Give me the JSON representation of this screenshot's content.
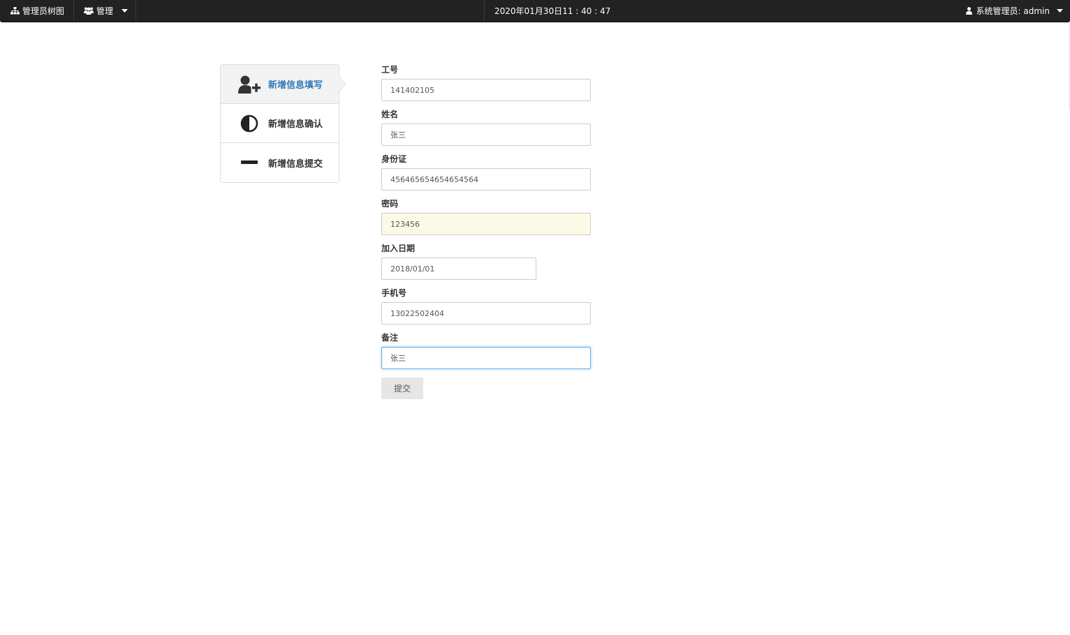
{
  "navbar": {
    "tree_label": "管理员树图",
    "manage_label": "管理",
    "clock": "2020年01月30日11 : 40 : 47",
    "user_label": "系统管理员: admin"
  },
  "steps": [
    {
      "label": "新增信息填写",
      "icon": "user-plus-icon",
      "active": true
    },
    {
      "label": "新增信息确认",
      "icon": "adjust-icon",
      "active": false
    },
    {
      "label": "新增信息提交",
      "icon": "minus-icon",
      "active": false
    }
  ],
  "form": {
    "employee_id": {
      "label": "工号",
      "value": "141402105"
    },
    "name": {
      "label": "姓名",
      "value": "张三"
    },
    "id_card": {
      "label": "身份证",
      "value": "456465654654654564"
    },
    "password": {
      "label": "密码",
      "value": "123456"
    },
    "join_date": {
      "label": "加入日期",
      "value": "2018/01/01"
    },
    "phone": {
      "label": "手机号",
      "value": "13022502404"
    },
    "remark": {
      "label": "备注",
      "value": "张三"
    },
    "submit_label": "提交"
  },
  "colors": {
    "navbar_bg": "#222222",
    "active_step_text": "#337ab7",
    "autofill_bg": "#fafae6",
    "focus_border": "#66afe9"
  }
}
